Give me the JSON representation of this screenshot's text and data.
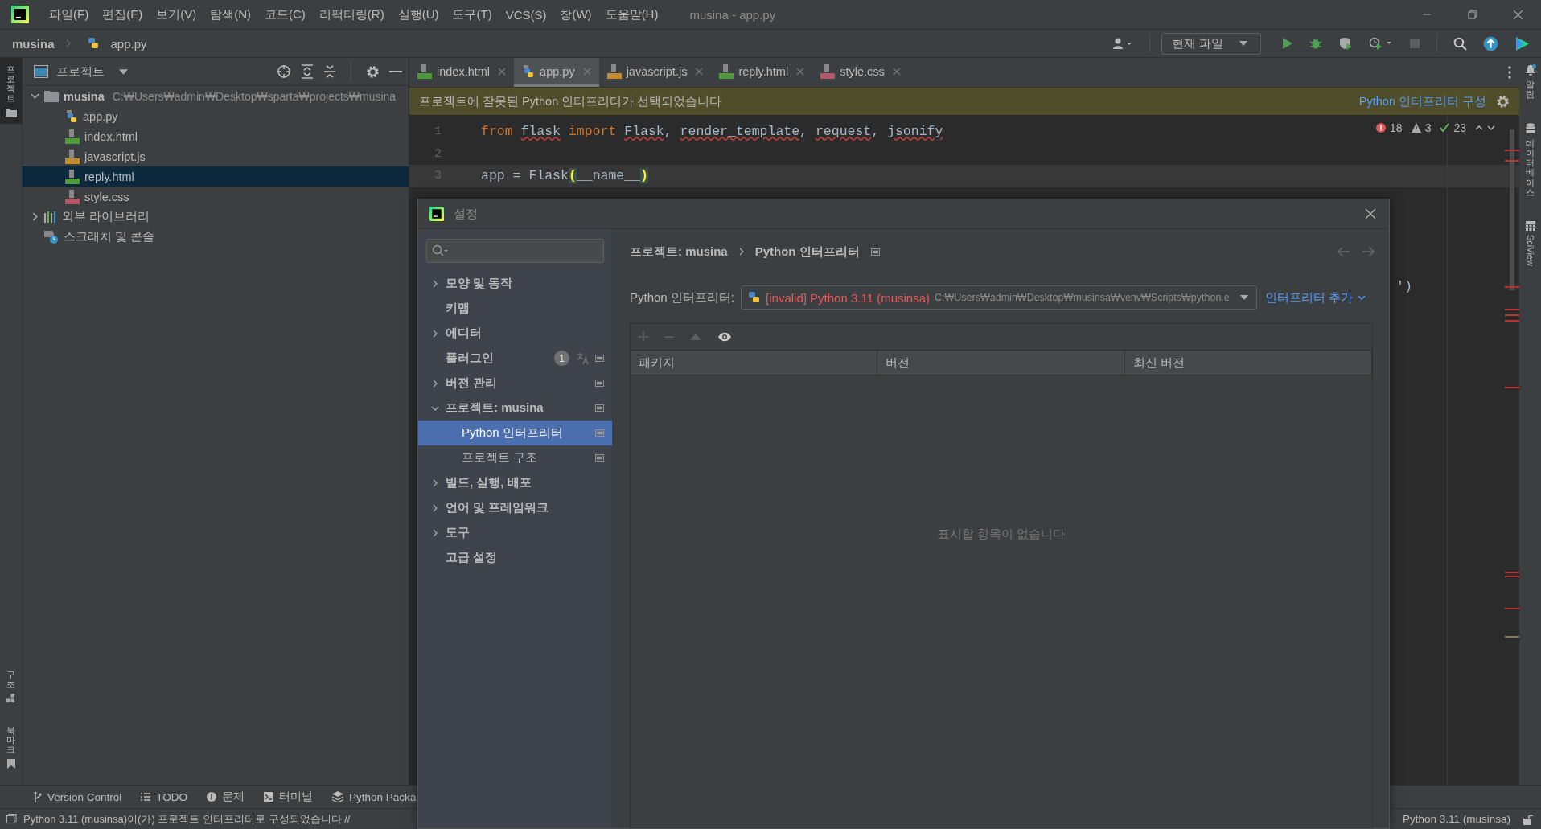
{
  "window": {
    "title": "musina - app.py"
  },
  "menu": [
    "파일(F)",
    "편집(E)",
    "보기(V)",
    "탐색(N)",
    "코드(C)",
    "리팩터링(R)",
    "실행(U)",
    "도구(T)",
    "VCS(S)",
    "창(W)",
    "도움말(H)"
  ],
  "breadcrumb": {
    "project": "musina",
    "file": "app.py"
  },
  "run_config": "현재 파일",
  "left_stripe": {
    "top": [
      {
        "label": "프로젝트",
        "selected": true
      }
    ],
    "bottom": [
      {
        "label": "구조",
        "selected": false
      },
      {
        "label": "북마크",
        "selected": false
      }
    ]
  },
  "right_stripe": [
    {
      "label": "알림",
      "kind": "stacked"
    },
    {
      "label": "데이터베이스",
      "kind": "stacked"
    },
    {
      "label": "SciView",
      "kind": "rotated"
    }
  ],
  "project": {
    "title": "프로젝트",
    "tree": [
      {
        "label": "musina",
        "path": "C:₩Users₩admin₩Desktop₩sparta₩projects₩musina",
        "kind": "folder",
        "expanded": true,
        "selected": false,
        "children": [
          {
            "label": "app.py",
            "kind": "python",
            "selected": false
          },
          {
            "label": "index.html",
            "kind": "html",
            "selected": false
          },
          {
            "label": "javascript.js",
            "kind": "js",
            "selected": false
          },
          {
            "label": "reply.html",
            "kind": "html",
            "selected": true
          },
          {
            "label": "style.css",
            "kind": "css",
            "selected": false
          }
        ]
      },
      {
        "label": "외부 라이브러리",
        "kind": "library",
        "expanded": false,
        "selected": false
      },
      {
        "label": "스크래치 및 콘솔",
        "kind": "scratch",
        "selected": false
      }
    ]
  },
  "tabs": [
    {
      "label": "index.html",
      "kind": "html",
      "selected": false
    },
    {
      "label": "app.py",
      "kind": "python",
      "selected": true
    },
    {
      "label": "javascript.js",
      "kind": "js",
      "selected": false
    },
    {
      "label": "reply.html",
      "kind": "html",
      "selected": false
    },
    {
      "label": "style.css",
      "kind": "css",
      "selected": false
    }
  ],
  "notice": {
    "message": "프로젝트에 잘못된 Python 인터프리터가 선택되었습니다",
    "action": "Python 인터프리터 구성"
  },
  "editor": {
    "lines": [
      {
        "number": "1",
        "current": false,
        "tokens": [
          {
            "t": "from ",
            "kind": "keyword"
          },
          {
            "t": "flask",
            "kind": "unresolved"
          },
          {
            "t": " import ",
            "kind": "keyword"
          },
          {
            "t": "Flask",
            "kind": "unresolved"
          },
          {
            "t": ", ",
            "kind": "plain"
          },
          {
            "t": "render_template",
            "kind": "unresolved"
          },
          {
            "t": ", ",
            "kind": "plain"
          },
          {
            "t": "request",
            "kind": "unresolved"
          },
          {
            "t": ", ",
            "kind": "plain"
          },
          {
            "t": "jsonify",
            "kind": "unresolved"
          }
        ]
      },
      {
        "number": "2",
        "current": false
      },
      {
        "number": "3",
        "current": true,
        "tokens": [
          {
            "t": "app = Flask",
            "kind": "plain"
          },
          {
            "t": "(",
            "kind": "bracket"
          },
          {
            "t": "__name__",
            "kind": "plain"
          },
          {
            "t": ")",
            "kind": "bracket"
          }
        ]
      }
    ],
    "tail": "')",
    "inspection": {
      "errors": "18",
      "warnings": "3",
      "passed": "23"
    }
  },
  "tool_windows": [
    {
      "label": "Version Control",
      "kind": "vcs"
    },
    {
      "label": "TODO",
      "kind": "todo"
    },
    {
      "label": "문제",
      "kind": "problems"
    },
    {
      "label": "터미널",
      "kind": "terminal"
    },
    {
      "label": "Python Packa",
      "kind": "packages"
    }
  ],
  "status": {
    "message": "Python 3.11 (musinsa)이(가) 프로젝트 인터프리터로 구성되었습니다 //",
    "interpreter": "Python 3.11 (musinsa)"
  },
  "dialog": {
    "title": "설정",
    "nav": [
      {
        "label": "모양 및 동작",
        "expanded": false,
        "selected": false,
        "scoped": false
      },
      {
        "label": "키맵",
        "selected": false,
        "scoped": false
      },
      {
        "label": "에디터",
        "expanded": false,
        "selected": false,
        "scoped": false
      },
      {
        "label": "플러그인",
        "selected": false,
        "badge": "1",
        "scoped": true
      },
      {
        "label": "버전 관리",
        "expanded": false,
        "selected": false,
        "scoped": true
      },
      {
        "label": "프로젝트: musina",
        "expanded": true,
        "selected": false,
        "scoped": true,
        "children": [
          {
            "label": "Python 인터프리터",
            "selected": true,
            "scoped": true
          },
          {
            "label": "프로젝트 구조",
            "selected": false,
            "scoped": true
          }
        ]
      },
      {
        "label": "빌드, 실행, 배포",
        "expanded": false,
        "selected": false,
        "scoped": false
      },
      {
        "label": "언어 및 프레임워크",
        "expanded": false,
        "selected": false,
        "scoped": false
      },
      {
        "label": "도구",
        "expanded": false,
        "selected": false,
        "scoped": false
      },
      {
        "label": "고급 설정",
        "selected": false,
        "scoped": false
      }
    ],
    "breadcrumb": [
      "프로젝트: musina",
      "Python 인터프리터"
    ],
    "interpreter": {
      "label": "Python 인터프리터:",
      "name": "[invalid] Python 3.11 (musinsa)",
      "invalid": true,
      "path": "C:₩Users₩admin₩Desktop₩musinsa₩venv₩Scripts₩python.e"
    },
    "add_link": "인터프리터 추가",
    "table": {
      "columns": [
        "패키지",
        "버전",
        "최신 버전"
      ],
      "empty": "표시할 항목이 없습니다"
    }
  }
}
